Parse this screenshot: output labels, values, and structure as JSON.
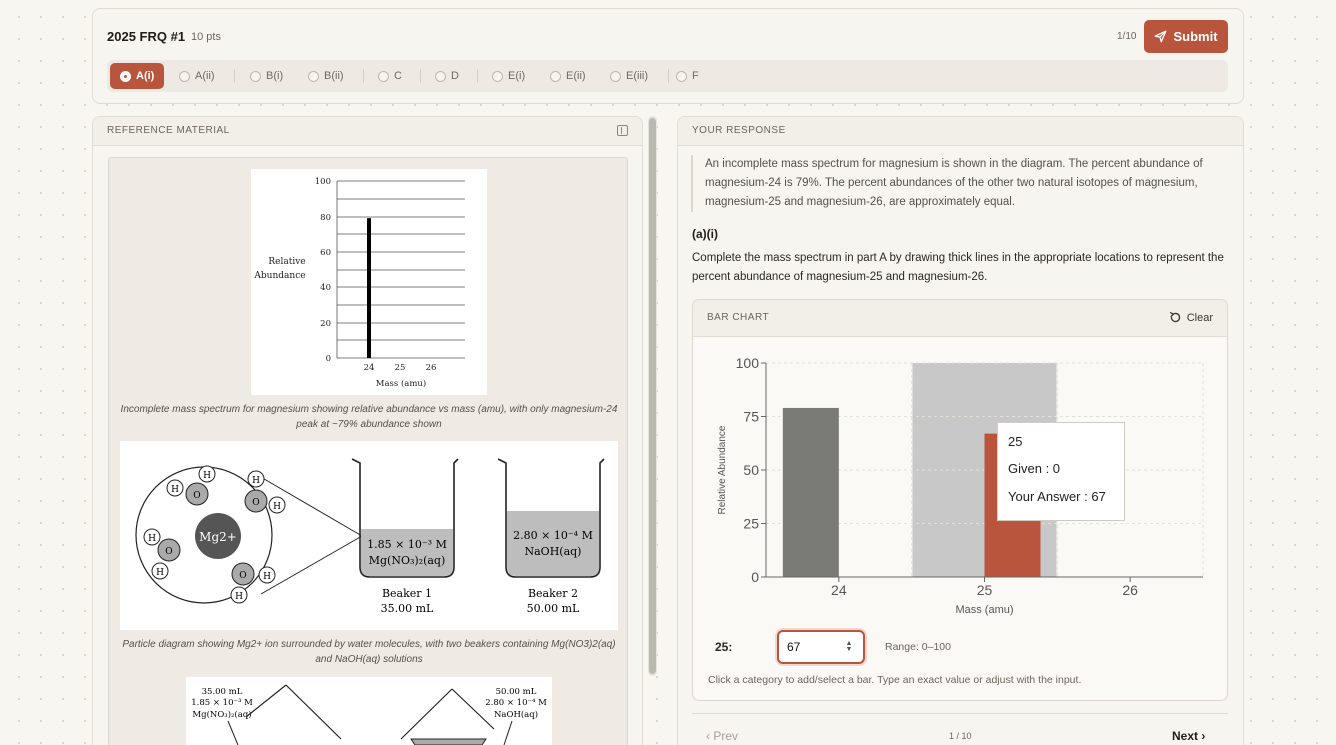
{
  "header": {
    "title": "2025 FRQ #1",
    "points": "10 pts",
    "counter": "1/10",
    "submit_label": "Submit"
  },
  "tabs": [
    {
      "label": "A(i)",
      "active": true
    },
    {
      "label": "A(ii)",
      "active": false
    },
    {
      "label": "B(i)",
      "active": false
    },
    {
      "label": "B(ii)",
      "active": false
    },
    {
      "label": "C",
      "active": false
    },
    {
      "label": "D",
      "active": false
    },
    {
      "label": "E(i)",
      "active": false
    },
    {
      "label": "E(ii)",
      "active": false
    },
    {
      "label": "E(iii)",
      "active": false
    },
    {
      "label": "F",
      "active": false
    }
  ],
  "reference": {
    "heading": "REFERENCE MATERIAL",
    "figure1": {
      "ylabel_line1": "Relative",
      "ylabel_line2": "Abundance",
      "xlabel": "Mass (amu)",
      "y_ticks": [
        "100",
        "80",
        "60",
        "40",
        "20",
        "0"
      ],
      "x_ticks": [
        "24",
        "25",
        "26"
      ],
      "caption": "Incomplete mass spectrum for magnesium showing relative abundance vs mass (amu), with only magnesium-24 peak at ~79% abundance shown"
    },
    "figure2": {
      "ion_label": "Mg2+",
      "h_label": "H",
      "o_label": "O",
      "beaker1_conc": "1.85 × 10⁻³ M",
      "beaker1_solution": "Mg(NO₃)₂(aq)",
      "beaker1_name": "Beaker 1",
      "beaker1_volume": "35.00 mL",
      "beaker2_conc": "2.80 × 10⁻⁴ M",
      "beaker2_solution": "NaOH(aq)",
      "beaker2_name": "Beaker 2",
      "beaker2_volume": "50.00 mL",
      "caption": "Particle diagram showing Mg2+ ion surrounded by water molecules, with two beakers containing Mg(NO3)2(aq) and NaOH(aq) solutions"
    },
    "figure3": {
      "left_volume": "35.00 mL",
      "left_conc": "1.85 × 10⁻³ M",
      "left_solution": "Mg(NO₃)₂(aq)",
      "right_volume": "50.00 mL",
      "right_conc": "2.80 × 10⁻⁴ M",
      "right_solution": "NaOH(aq)"
    }
  },
  "response": {
    "heading": "YOUR RESPONSE",
    "prompt": "An incomplete mass spectrum for magnesium is shown in the diagram. The percent abundance of magnesium-24 is 79%. The percent abundances of the other two natural isotopes of magnesium, magnesium-25 and magnesium-26, are approximately equal.",
    "part_label": "(a)(i)",
    "question": "Complete the mass spectrum in part A by drawing thick lines in the appropriate locations to represent the percent abundance of magnesium-25 and magnesium-26.",
    "chart_card_title": "BAR CHART",
    "clear_label": "Clear",
    "tooltip": {
      "category": "25",
      "given_text": "Given : 0",
      "answer_text": "Your Answer : 67"
    },
    "edit": {
      "label": "25:",
      "value": "67",
      "range": "Range: 0–100"
    },
    "help": "Click a category to add/select a bar. Type an exact value or adjust with the input.",
    "prev_label": "Prev",
    "page_indicator": "1 / 10",
    "next_label": "Next"
  },
  "colors": {
    "accent": "#b8553c",
    "given_bar": "#7a7a76",
    "hover_band": "#c8c8c8"
  },
  "chart_data": [
    {
      "type": "bar",
      "chart": "reference-mass-spectrum",
      "categories": [
        "24",
        "25",
        "26"
      ],
      "values": [
        79,
        null,
        null
      ],
      "ylim": [
        0,
        100
      ],
      "xlabel": "Mass (amu)",
      "ylabel": "Relative Abundance",
      "grid": true
    },
    {
      "type": "bar",
      "chart": "response-bar-chart",
      "categories": [
        "24",
        "25",
        "26"
      ],
      "series": [
        {
          "name": "Given",
          "values": [
            79,
            0,
            0
          ]
        },
        {
          "name": "Your Answer",
          "values": [
            0,
            67,
            0
          ]
        }
      ],
      "ylim": [
        0,
        100
      ],
      "y_ticks": [
        0,
        25,
        50,
        75,
        100
      ],
      "xlabel": "Mass (amu)",
      "ylabel": "Relative Abundance",
      "grid": true,
      "hovered_category": "25"
    }
  ]
}
